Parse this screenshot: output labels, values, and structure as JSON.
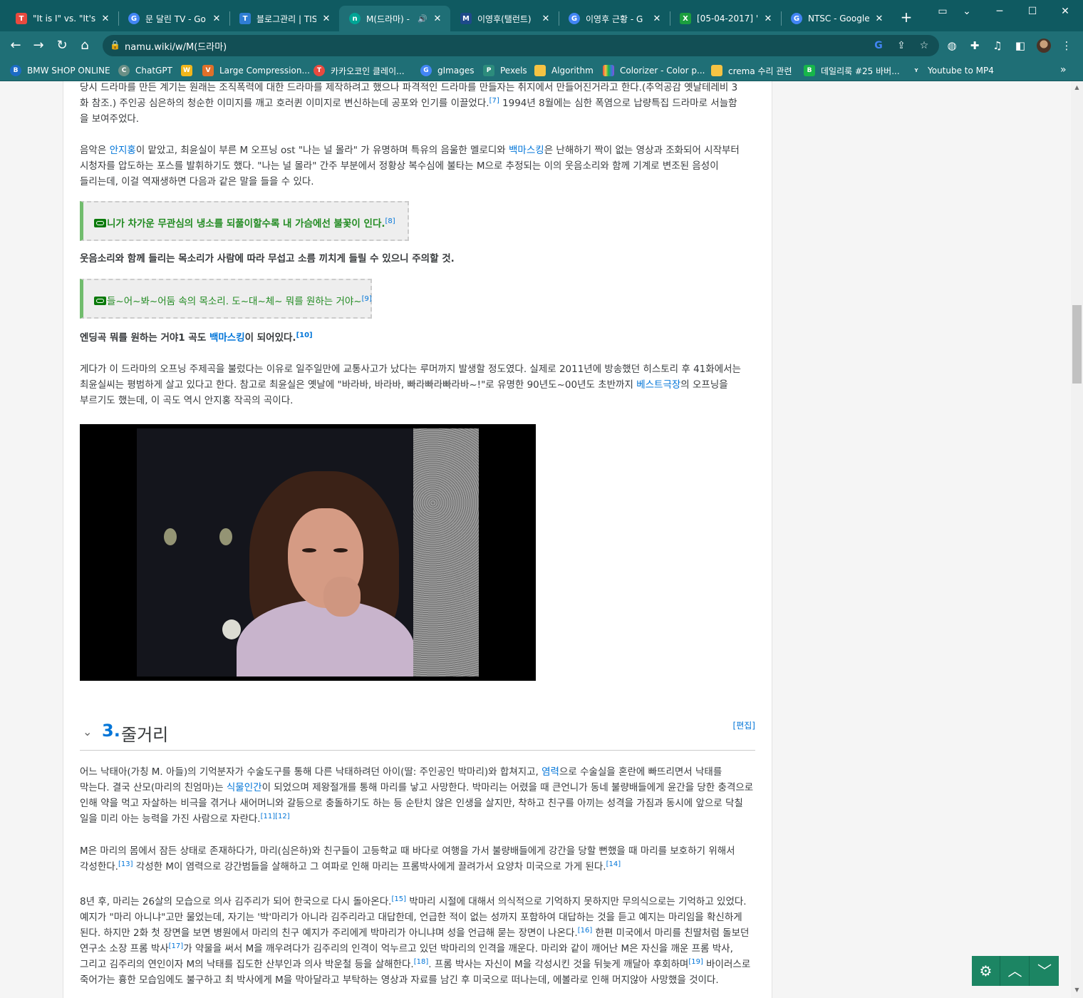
{
  "browser": {
    "tabs": [
      {
        "title": "\"It is I\" vs. \"It's M",
        "favicon_color": "#e84a3f",
        "favicon_letter": "T"
      },
      {
        "title": "문 달린 TV - Go",
        "favicon_color": "#4285f4",
        "favicon_letter": "G"
      },
      {
        "title": "블로그관리 | TIS",
        "favicon_color": "#2f7dd3",
        "favicon_letter": "T"
      },
      {
        "title": "M(드라마) -",
        "favicon_color": "#00a495",
        "favicon_letter": "n"
      },
      {
        "title": "이영후(탤런트)",
        "favicon_color": "#1e4a8a",
        "favicon_letter": "M"
      },
      {
        "title": "이영후 근황 - G",
        "favicon_color": "#4285f4",
        "favicon_letter": "G"
      },
      {
        "title": "[05-04-2017] \"",
        "favicon_color": "#1b9e3e",
        "favicon_letter": "X"
      },
      {
        "title": "NTSC - Google",
        "favicon_color": "#4285f4",
        "favicon_letter": "G"
      }
    ],
    "active_tab": 3,
    "url": "namu.wiki/w/M(드라마)",
    "bookmarks": [
      {
        "label": "BMW SHOP ONLINE",
        "color": "#1c6bc4",
        "letter": "B"
      },
      {
        "label": "ChatGPT",
        "color": "#6a8f86",
        "letter": "C"
      },
      {
        "label": "",
        "color": "#f2b61b",
        "letter": "W"
      },
      {
        "label": "Large Compression...",
        "color": "#e0702a",
        "letter": "V"
      },
      {
        "label": "카카오코인 클레이...",
        "color": "#e84a3f",
        "letter": "T"
      },
      {
        "label": "gImages",
        "color": "#4285f4",
        "letter": "G"
      },
      {
        "label": "Pexels",
        "color": "#2c8c7c",
        "letter": "P"
      },
      {
        "label": "Algorithm",
        "color": "#f6c343",
        "letter": ""
      },
      {
        "label": "Colorizer - Color p...",
        "color": "#8b4fd6",
        "letter": ""
      },
      {
        "label": "crema 수리 관련",
        "color": "#f6c343",
        "letter": ""
      },
      {
        "label": "데일리룩 #25 바버...",
        "color": "#17b64a",
        "letter": "B"
      },
      {
        "label": "Youtube to MP4",
        "color": "#1f6f76",
        "letter": "Y"
      }
    ]
  },
  "article": {
    "p1": {
      "line1": "당시 드라마를 만든 계기는 원래는 조직폭력에 대한 드라마를 제작하려고 했으나 파격적인 드라마를 만들자는 취지에서 만들어진거라고 한다.(추억공감 옛날테레비 3",
      "line2": "화 참조.) 주인공 심은하의 청순한 이미지를 깨고 호러퀸 이미지로 변신하는데 공포와 인기를 이끌었다.",
      "ref1": "[7]",
      "line2b": " 1994년 8월에는 심한 폭염으로 납량특집 드라마로 서늘함",
      "line3": "을 보여주었다."
    },
    "p2": {
      "t1": "음악은 ",
      "link1": "안지홍",
      "t2": "이 맡았고, 최윤실이 부른 M 오프닝 ost \"나는 널 몰라\" 가 유명하며 특유의 음울한 멜로디와 ",
      "link2": "백마스킹",
      "t3": "은 난해하기 짝이 없는 영상과 조화되어 시작부터 시청자를 압도하는 포스를 발휘하기도 했다. \"나는 널 몰라\" 간주 부분에서 정황상 복수심에 불타는 M으로 추정되는 이의 웃음소리와 함께 기계로 변조된 음성이 들리는데, 이걸 역재생하면 다음과 같은 말을 들을 수 있다."
    },
    "quote1": {
      "text": "니가 차가운 무관심의 냉소를 되풀이할수록 내 가슴에선 불꽃이 인다.",
      "ref": "[8]"
    },
    "p3": "웃음소리와 함께 들리는 목소리가 사람에 따라 무섭고 소름 끼치게 들릴 수 있으니 주의할 것.",
    "quote2": {
      "text": "들~어~봐~어둠 속의 목소리. 도~대~체~ 뭐를 원하는 거야~",
      "ref": "[9]"
    },
    "p4": {
      "t1": "엔딩곡 뭐를 원하는 거야1 곡도 ",
      "link": "백마스킹",
      "t2": "이 되어있다.",
      "ref": "[10]"
    },
    "p5": {
      "t1": "게다가 이 드라마의 오프닝 주제곡을 불렀다는 이유로 일주일만에 교통사고가 났다는 루머까지 발생할 정도였다. 실제로 2011년에 방송했던 히스토리 후 41화에서는 최윤실씨는 평범하게 살고 있다고 한다. 참고로 최윤실은 옛날에 \"바라바, 바라바, 빠라빠라빠라바~!\"로 유명한 90년도~00년도 초반까지 ",
      "link": "베스트극장",
      "t2": "의 오프닝을 부르기도 했는데, 이 곡도 역시 안지홍 작곡의 곡이다."
    },
    "section": {
      "num": "3.",
      "title": "줄거리",
      "edit": "[편집]"
    },
    "s1": {
      "t1": "어느 낙태아(가칭 M. 아들)의 기억분자가 수술도구를 통해 다른 낙태하려던 아이(딸: 주인공인 박마리)와 합쳐지고, ",
      "link1": "염력",
      "t2": "으로 수술실을 혼란에 빠뜨리면서 낙태를 막는다. 결국 산모(마리의 친엄마)는 ",
      "link2": "식물인간",
      "t3": "이 되었으며 제왕절개를 통해 마리를 낳고 사망한다. 박마리는 어렸을 때 큰언니가 동네 불량배들에게 윤간을 당한 충격으로 인해 약을 먹고 자살하는 비극을 겪거나 새어머니와 갈등으로 충돌하기도 하는 등 순탄치 않은 인생을 살지만, 착하고 친구를 아끼는 성격을 가짐과 동시에 앞으로 닥칠 일을 미리 아는 능력을 가진 사람으로 자란다.",
      "ref": "[11][12]"
    },
    "s2": {
      "t1": "M은 마리의 몸에서 잠든 상태로 존재하다가, 마리(심은하)와 친구들이 고등학교 때 바다로 여행을 가서 불량배들에게 강간을 당할 뻔했을 때 마리를 보호하기 위해서 각성한다.",
      "ref1": "[13]",
      "t2": " 각성한 M이 염력으로 강간범들을 살해하고 그 여파로 인해 마리는 프롬박사에게 끌려가서 요양차 미국으로 가게 된다.",
      "ref2": "[14]"
    },
    "s3": {
      "t1": "8년 후, 마리는 26살의 모습으로 의사 김주리가 되어 한국으로 다시 돌아온다.",
      "ref1": "[15]",
      "t2": " 박마리 시절에 대해서 의식적으로 기억하지 못하지만 무의식으로는 기억하고 있었다. 예지가 \"마리 아니냐\"고만 물었는데, 자기는 '박'마리가 아니라 김주리라고 대답한데, 언급한 적이 없는 성까지 포함하여 대답하는 것을 듣고 예지는 마리임을 확신하게 된다. 하지만 2화 첫 장면을 보면 병원에서 마리의 친구 예지가 주리에게 박마리가 아니냐며 성을 언급해 묻는 장면이 나온다.",
      "ref2": "[16]",
      "t3": " 한편 미국에서 마리를 친딸처럼 돌보던 연구소 소장 프롬 박사",
      "ref3": "[17]",
      "t4": "가 약물을 써서 M을 깨우려다가 김주리의 인격이 억누르고 있던 박마리의 인격을 깨운다. 마리와 같이 깨어난 M은 자신을 깨운 프롬 박사, 그리고 김주리의 연인이자 M의 낙태를 집도한 산부인과 의사 박운철 등을 살해한다.",
      "ref4": "[18]",
      "t5": ". 프롬 박사는 자신이 M을 각성시킨 것을 뒤늦게 깨달아 후회하며",
      "ref5": "[19]",
      "t6": " 바이러스로 죽어가는 흉한 모습임에도 불구하고 최 박사에게 M을 막아달라고 부탁하는 영상과 자료를 남긴 후 미국으로 떠나는데, 에볼라로 인해 머지않아 사망했을 것이다."
    }
  }
}
